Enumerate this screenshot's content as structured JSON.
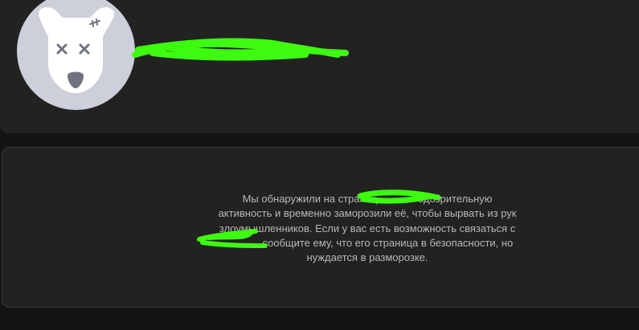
{
  "profile": {
    "avatar_icon": "deleted-user-dog-icon",
    "name_redacted": true
  },
  "notice": {
    "lines": [
      "Мы обнаружили на страниц              одозрительную",
      "активность и временно заморозили её, чтобы вырвать из рук",
      "злоумышленников. Если у вас есть возможность связаться с",
      "              сообщите ему, что его страница в безопасности, но",
      "нуждается в разморозке."
    ],
    "redaction_color": "#3dfc0f"
  },
  "colors": {
    "background": "#141414",
    "card": "#222222",
    "text": "#b8b8b8",
    "avatar_bg": "#cdd0db",
    "avatar_face": "#ffffff",
    "avatar_features": "#6f7380"
  }
}
